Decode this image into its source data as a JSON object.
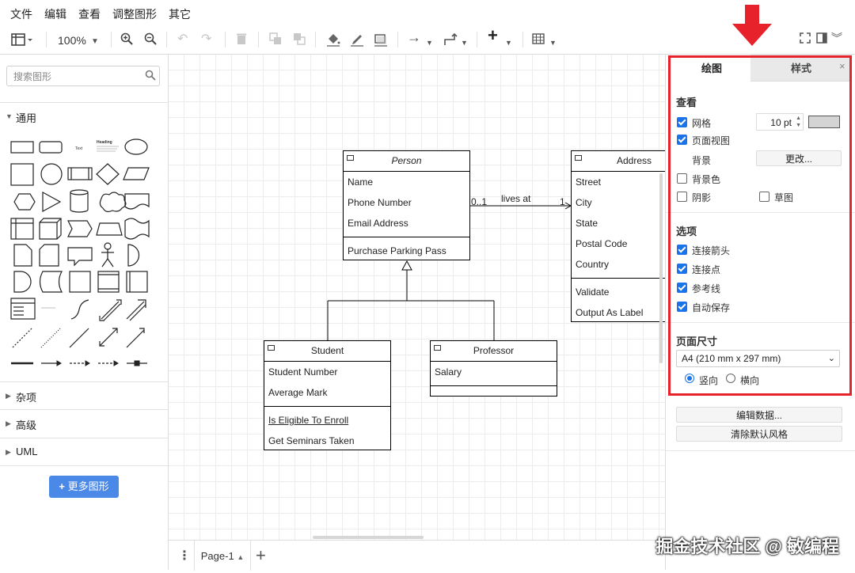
{
  "menu": [
    "文件",
    "编辑",
    "查看",
    "调整图形",
    "其它"
  ],
  "toolbar": {
    "zoom": "100%"
  },
  "sidebar": {
    "search_placeholder": "搜索图形",
    "sections": [
      "通用",
      "杂项",
      "高级",
      "UML"
    ],
    "more_shapes": "更多图形",
    "shape_text": "Text",
    "shape_heading": "Heading"
  },
  "diagram": {
    "person": {
      "title": "Person",
      "attributes": [
        "Name",
        "Phone Number",
        "Email Address"
      ],
      "methods": [
        "Purchase Parking Pass"
      ]
    },
    "address": {
      "title": "Address",
      "attributes": [
        "Street",
        "City",
        "State",
        "Postal Code",
        "Country"
      ],
      "methods": [
        "Validate",
        "Output As Label"
      ]
    },
    "student": {
      "title": "Student",
      "attributes": [
        "Student Number",
        "Average Mark"
      ],
      "methods": [
        "Is Eligible To Enroll",
        "Get Seminars Taken"
      ]
    },
    "professor": {
      "title": "Professor",
      "attributes": [
        "Salary"
      ]
    },
    "association": {
      "label": "lives at",
      "source_mult": "0..1",
      "target_mult": "1"
    }
  },
  "page_tab": "Page-1",
  "panel": {
    "tabs": [
      "绘图",
      "样式"
    ],
    "view": {
      "title": "查看",
      "grid": {
        "label": "网格",
        "checked": true,
        "size": "10 pt",
        "color": "#d4d4d4"
      },
      "page_view": {
        "label": "页面视图",
        "checked": true
      },
      "background_label": "背景",
      "change_button": "更改...",
      "bg_color": {
        "label": "背景色",
        "checked": false
      },
      "shadow": {
        "label": "阴影",
        "checked": false
      },
      "sketch": {
        "label": "草图",
        "checked": false
      }
    },
    "options": {
      "title": "选项",
      "items": [
        {
          "label": "连接箭头",
          "checked": true
        },
        {
          "label": "连接点",
          "checked": true
        },
        {
          "label": "参考线",
          "checked": true
        },
        {
          "label": "自动保存",
          "checked": true
        }
      ]
    },
    "page_size": {
      "title": "页面尺寸",
      "selected": "A4 (210 mm x 297 mm)",
      "portrait": "竖向",
      "landscape": "横向",
      "orientation": "portrait"
    },
    "edit_data": "编辑数据...",
    "clear_style": "清除默认风格"
  },
  "watermark": "掘金技术社区 @ 敏编程",
  "colors": {
    "highlight": "#e8222a",
    "accent": "#1a73e8",
    "button_blue": "#4b89e8"
  }
}
